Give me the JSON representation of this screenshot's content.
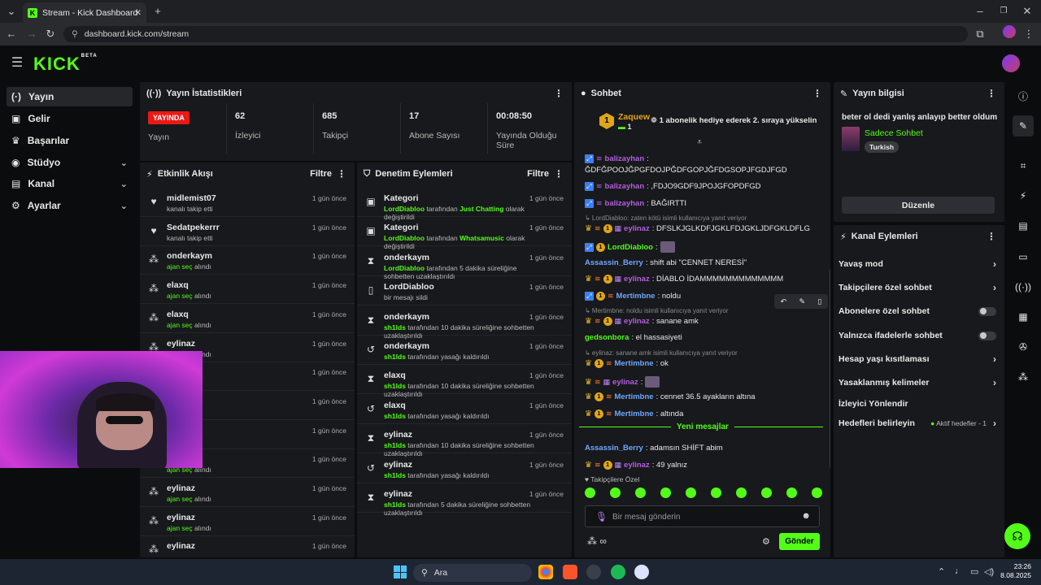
{
  "browser": {
    "tab_title": "Stream - Kick Dashboard",
    "url": "dashboard.kick.com/stream",
    "new_tab": "+"
  },
  "kick": {
    "logo": "KICK",
    "logo_beta": "BETA"
  },
  "sidebar": {
    "items": [
      {
        "label": "Yayın",
        "icon": "broadcast-icon",
        "active": true
      },
      {
        "label": "Gelir",
        "icon": "wallet-icon"
      },
      {
        "label": "Başarılar",
        "icon": "trophy-icon"
      },
      {
        "label": "Stüdyo",
        "icon": "studio-icon",
        "chevron": true
      },
      {
        "label": "Kanal",
        "icon": "channel-icon",
        "chevron": true
      },
      {
        "label": "Ayarlar",
        "icon": "gear-icon",
        "chevron": true
      }
    ]
  },
  "stats": {
    "title": "Yayın İstatistikleri",
    "live_badge": "YAYINDA",
    "live_label": "Yayın",
    "viewers_value": "62",
    "viewers_label": "İzleyici",
    "followers_value": "685",
    "followers_label": "Takipçi",
    "subs_value": "17",
    "subs_label": "Abone Sayısı",
    "uptime_value": "00:08:50",
    "uptime_label": "Yayında Olduğu Süre"
  },
  "activity": {
    "title": "Etkinlik Akışı",
    "filter": "Filtre",
    "items": [
      {
        "user": "midlemist07",
        "desc": "kanalı takip etti",
        "time": "1 gün önce",
        "icon": "heart-icon"
      },
      {
        "user": "Sedatpekerrr",
        "desc": "kanalı takip etti",
        "time": "1 gün önce",
        "icon": "heart-icon"
      },
      {
        "user": "onderkaym",
        "hl": "ajan seç",
        "desc": " alındı",
        "time": "1 gün önce",
        "icon": "reward-icon"
      },
      {
        "user": "elaxq",
        "hl": "ajan seç",
        "desc": " alındı",
        "time": "1 gün önce",
        "icon": "reward-icon"
      },
      {
        "user": "elaxq",
        "hl": "ajan seç",
        "desc": " alındı",
        "time": "1 gün önce",
        "icon": "reward-icon"
      },
      {
        "user": "eylinaz",
        "hl": "ajan seç",
        "desc": " alındı",
        "time": "1 gün önce",
        "icon": "reward-icon"
      },
      {
        "user": "",
        "hl": "",
        "desc": "",
        "time": "1 gün önce",
        "icon": "reward-icon"
      },
      {
        "user": "",
        "hl": "",
        "desc": "",
        "time": "1 gün önce",
        "icon": "reward-icon"
      },
      {
        "user": "",
        "hl": "",
        "desc": "",
        "time": "1 gün önce",
        "icon": "reward-icon"
      },
      {
        "user": "",
        "hl": "ajan seç",
        "desc": " alındı",
        "time": "1 gün önce",
        "icon": "reward-icon"
      },
      {
        "user": "eylinaz",
        "hl": "ajan seç",
        "desc": " alındı",
        "time": "1 gün önce",
        "icon": "reward-icon"
      },
      {
        "user": "eylinaz",
        "hl": "ajan seç",
        "desc": " alındı",
        "time": "1 gün önce",
        "icon": "reward-icon"
      },
      {
        "user": "eylinaz",
        "hl": "",
        "desc": "",
        "time": "1 gün önce",
        "icon": "reward-icon"
      }
    ]
  },
  "moderation": {
    "title": "Denetim Eylemleri",
    "filter": "Filtre",
    "items": [
      {
        "title": "Kategori",
        "by": "LordDiabloo",
        "mid": " tarafından ",
        "hl": "Just Chatting",
        "rest": " olarak değiştirildi",
        "time": "1 gün önce",
        "icon": "category-icon"
      },
      {
        "title": "Kategori",
        "by": "LordDiabloo",
        "mid": " tarafından ",
        "hl": "Whatsamusic",
        "rest": " olarak değiştirildi",
        "time": "1 gün önce",
        "icon": "category-icon"
      },
      {
        "title": "onderkaym",
        "by": "LordDiabloo",
        "mid": " tarafından 5 dakika süreliğine sohbetten uzaklaştırıldı",
        "hl": "",
        "rest": "",
        "time": "1 gün önce",
        "icon": "hourglass-icon"
      },
      {
        "title": "LordDiabloo",
        "by": "",
        "mid": "bir mesajı sildi",
        "hl": "",
        "rest": "",
        "time": "1 gün önce",
        "icon": "trash-icon"
      },
      {
        "title": "onderkaym",
        "by": "sh1lds",
        "mid": " tarafından 10 dakika süreliğine sohbetten uzaklaştırıldı",
        "hl": "",
        "rest": "",
        "time": "1 gün önce",
        "icon": "hourglass-icon"
      },
      {
        "title": "onderkaym",
        "by": "sh1lds",
        "mid": " tarafından yasağı kaldırıldı",
        "hl": "",
        "rest": "",
        "time": "1 gün önce",
        "icon": "unban-icon"
      },
      {
        "title": "elaxq",
        "by": "sh1lds",
        "mid": " tarafından 10 dakika süreliğine sohbetten uzaklaştırıldı",
        "hl": "",
        "rest": "",
        "time": "1 gün önce",
        "icon": "hourglass-icon"
      },
      {
        "title": "elaxq",
        "by": "sh1lds",
        "mid": " tarafından yasağı kaldırıldı",
        "hl": "",
        "rest": "",
        "time": "1 gün önce",
        "icon": "unban-icon"
      },
      {
        "title": "eylinaz",
        "by": "sh1lds",
        "mid": " tarafından 10 dakika süreliğine sohbetten uzaklaştırıldı",
        "hl": "",
        "rest": "",
        "time": "1 gün önce",
        "icon": "hourglass-icon"
      },
      {
        "title": "eylinaz",
        "by": "sh1lds",
        "mid": " tarafından yasağı kaldırıldı",
        "hl": "",
        "rest": "",
        "time": "1 gün önce",
        "icon": "unban-icon"
      },
      {
        "title": "eylinaz",
        "by": "sh1lds",
        "mid": " tarafından 5 dakika süreliğine sohbetten uzaklaştırıldı",
        "hl": "",
        "rest": "",
        "time": "1 gün önce",
        "icon": "hourglass-icon"
      }
    ]
  },
  "chat": {
    "title": "Sohbet",
    "pinned_user": "Zaquew",
    "pinned_count": "1",
    "pinned_text": "1 abonelik hediye ederek 2. sıraya yükselin",
    "new_messages": "Yeni mesajlar",
    "followers_only_label": "Takipçilere Özel",
    "input_placeholder": "Bir mesaj gönderin",
    "send": "Gönder",
    "messages": [
      {
        "user": "balizayhan",
        "color": "#b35ee0",
        "text": ":",
        "badges": "bp"
      },
      {
        "user": "",
        "color": "#e8e8e8",
        "text": "ĞDFĞPOOJĞPGFDOJPĞDFGOPJĞFDGSOPJFGDJFGD",
        "badges": ""
      },
      {
        "user": "balizayhan",
        "color": "#b35ee0",
        "text": ": ,FDJO9GDF9JPOJGFOPDFGD",
        "badges": "bp"
      },
      {
        "user": "balizayhan",
        "color": "#b35ee0",
        "text": ": BAĞIRTTI",
        "badges": "bp"
      },
      {
        "reply": "LordDiabloo: zaten kötü isimli kullanıcıya yanıt veriyor"
      },
      {
        "user": "eylinaz",
        "color": "#b35ee0",
        "text": ": DFSLKJGLKDFJGKLFDJGKLJDFGKLDFLG",
        "badges": "cog"
      },
      {
        "user": "LordDiabloo",
        "color": "#53fc18",
        "text": ":",
        "badges": "bg",
        "emote": true
      },
      {
        "user": "Assassin_Berry",
        "color": "#6ea8ff",
        "text": ": shift abi \"CENNET NERESİ\"",
        "badges": ""
      },
      {
        "user": "eylinaz",
        "color": "#b35ee0",
        "text": ": DİABLO İDAMMMMMMMMMMMMM",
        "badges": "cog"
      },
      {
        "user": "Mertimbne",
        "color": "#6ea8ff",
        "text": ": noldu",
        "badges": "bgo"
      },
      {
        "reply": "Mertimbne: noldu isimli kullanıcıya yanıt veriyor"
      },
      {
        "user": "eylinaz",
        "color": "#b35ee0",
        "text": ": sanane amk",
        "badges": "cog"
      },
      {
        "user": "gedsonbora",
        "color": "#53fc18",
        "text": ": el hassasiyeti",
        "badges": ""
      },
      {
        "reply": "eylinaz: sanane amk isimli kullanıcıya yanıt veriyor"
      },
      {
        "user": "Mertimbne",
        "color": "#6ea8ff",
        "text": ": ok",
        "badges": "cgo"
      },
      {
        "user": "eylinaz",
        "color": "#b35ee0",
        "text": ":",
        "badges": "co",
        "emote": true
      },
      {
        "user": "Mertimbne",
        "color": "#6ea8ff",
        "text": ": cennet 36.5 ayakların altına",
        "badges": "cgo"
      },
      {
        "user": "Mertimbne",
        "color": "#6ea8ff",
        "text": ": altında",
        "badges": "cgo"
      },
      {
        "user": "Assassin_Berry",
        "color": "#6ea8ff",
        "text": ": adamsın SHİFT abim",
        "badges": ""
      },
      {
        "user": "eylinaz",
        "color": "#b35ee0",
        "text": ": 49 yalnız",
        "badges": "cog"
      }
    ]
  },
  "info": {
    "title": "Yayın bilgisi",
    "stream_title": "beter ol dedi yanlış anlayıp better oldum",
    "category": "Sadece Sohbet",
    "language": "Turkish",
    "edit": "Düzenle"
  },
  "channel_actions": {
    "title": "Kanal Eylemleri",
    "items": [
      {
        "label": "Yavaş mod",
        "type": "arrow"
      },
      {
        "label": "Takipçilere özel sohbet",
        "type": "arrow"
      },
      {
        "label": "Abonelere özel sohbet",
        "type": "toggle"
      },
      {
        "label": "Yalnızca ifadelerle sohbet",
        "type": "toggle"
      },
      {
        "label": "Hesap yaşı kısıtlaması",
        "type": "arrow"
      },
      {
        "label": "Yasaklanmış kelimeler",
        "type": "arrow"
      },
      {
        "label": "İzleyici Yönlendir",
        "type": "none"
      },
      {
        "label": "Hedefleri belirleyin",
        "type": "arrow",
        "extra": "Aktif hedefler - 1"
      }
    ]
  },
  "taskbar": {
    "search": "Ara",
    "time": "23:26",
    "date": "8.08.2025"
  },
  "colors": {
    "accent": "#53fc18",
    "live": "#e91916",
    "panel": "#18191c",
    "bg": "#0b0c0d"
  }
}
